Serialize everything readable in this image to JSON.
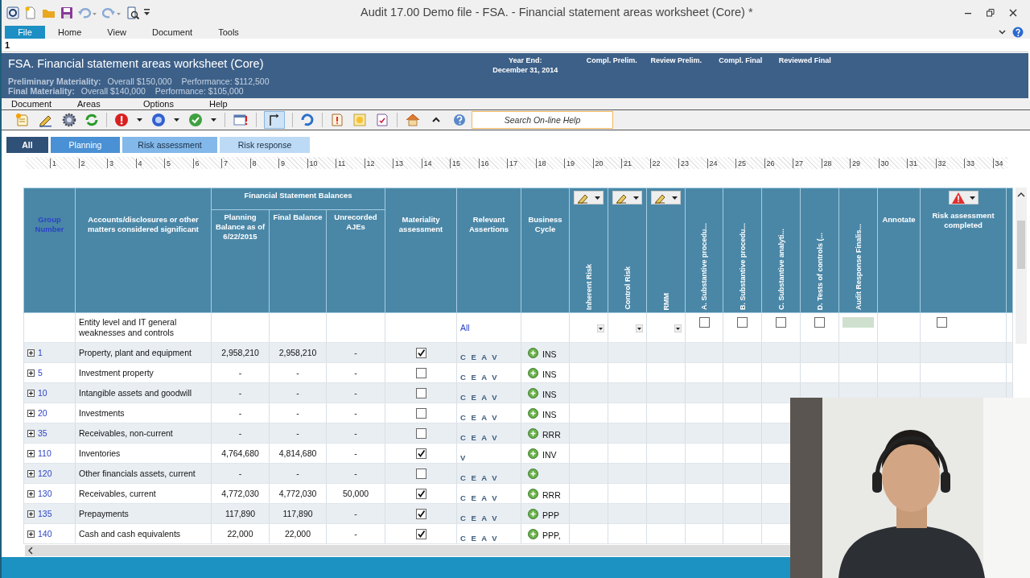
{
  "window": {
    "title": "Audit 17.00 Demo file - FSA. - Financial statement areas worksheet (Core) *"
  },
  "ribbon_tabs": [
    {
      "label": "File",
      "selected": true
    },
    {
      "label": "Home",
      "selected": false
    },
    {
      "label": "View",
      "selected": false
    },
    {
      "label": "Document",
      "selected": false
    },
    {
      "label": "Tools",
      "selected": false
    }
  ],
  "cell_editor": {
    "value": "1"
  },
  "document_header": {
    "title": "FSA. Financial statement areas worksheet (Core)",
    "materiality": [
      {
        "label": "Preliminary Materiality:",
        "overall": "Overall $150,000",
        "performance": "Performance: $112,500"
      },
      {
        "label": "Final Materiality:",
        "overall": "Overall $140,000",
        "performance": "Performance: $105,000"
      }
    ],
    "year_end": {
      "label": "Year End:",
      "value": "December 31, 2014"
    },
    "signoffs": [
      "Compl. Prelim.",
      "Review Prelim.",
      "Compl. Final",
      "Reviewed Final"
    ]
  },
  "menu": [
    "Document",
    "Areas",
    "Options",
    "Help"
  ],
  "search": {
    "placeholder": "Search On-line Help"
  },
  "filter_tabs": [
    {
      "label": "All",
      "selected": true
    },
    {
      "label": "Planning",
      "selected": false,
      "color": "#4a90d4"
    },
    {
      "label": "Risk assessment",
      "selected": false,
      "color": "#82b8ea"
    },
    {
      "label": "Risk response",
      "selected": false,
      "color": "#bcdaf5"
    }
  ],
  "ruler": [
    "1",
    "2",
    "3",
    "4",
    "5",
    "6",
    "7",
    "8",
    "9",
    "10",
    "11",
    "12",
    "13",
    "14",
    "15",
    "16",
    "17",
    "18",
    "19",
    "20",
    "21",
    "22",
    "23",
    "24",
    "25",
    "26",
    "27",
    "28",
    "29",
    "30",
    "31",
    "32",
    "33",
    "34"
  ],
  "table": {
    "columns": [
      {
        "kind": "link",
        "label": "Group Number"
      },
      {
        "kind": "text",
        "label": "Accounts/disclosures or other matters considered significant"
      },
      {
        "kind": "group",
        "label": "Financial Statement Balances",
        "columns": [
          {
            "label": "Planning Balance as of 6/22/2015"
          },
          {
            "label": "Final Balance"
          },
          {
            "label": "Unrecorded AJEs"
          }
        ]
      },
      {
        "kind": "text",
        "label": "Materiality assessment"
      },
      {
        "kind": "text",
        "label": "Relevant Assertions"
      },
      {
        "kind": "text",
        "label": "Business Cycle"
      },
      {
        "kind": "vertical_menu",
        "label": "Inherent Risk"
      },
      {
        "kind": "vertical_menu",
        "label": "Control Risk"
      },
      {
        "kind": "vertical_menu",
        "label": "RMM"
      },
      {
        "kind": "vertical",
        "label": "A. Substantive procedu..."
      },
      {
        "kind": "vertical",
        "label": "B. Substantive procedu..."
      },
      {
        "kind": "vertical",
        "label": "C. Substantive analyti..."
      },
      {
        "kind": "vertical",
        "label": "D. Tests of controls (..."
      },
      {
        "kind": "vertical",
        "label": "Audit Response Finalis..."
      },
      {
        "kind": "text",
        "label": "Annotate"
      },
      {
        "kind": "warning_menu",
        "label": "Risk assessment completed"
      }
    ],
    "entity_row": {
      "account": "Entity level and IT general weaknesses and controls",
      "assertions": "All",
      "procedures_checked": [
        false,
        false,
        false,
        false
      ],
      "risk_assessment_completed": false
    },
    "rows": [
      {
        "group": "1",
        "expanded": false,
        "account": "Property, plant and equipment",
        "planning": "2,958,210",
        "final": "2,958,210",
        "unrecorded": "-",
        "materiality_assessed": true,
        "assertions": "C E A V",
        "cycle": "INS"
      },
      {
        "group": "5",
        "expanded": false,
        "account": "Investment property",
        "planning": "-",
        "final": "-",
        "unrecorded": "-",
        "materiality_assessed": false,
        "assertions": "C E A V",
        "cycle": "INS"
      },
      {
        "group": "10",
        "expanded": false,
        "account": "Intangible assets and goodwill",
        "planning": "-",
        "final": "-",
        "unrecorded": "-",
        "materiality_assessed": false,
        "assertions": "C E A V",
        "cycle": "INS"
      },
      {
        "group": "20",
        "expanded": false,
        "account": "Investments",
        "planning": "-",
        "final": "-",
        "unrecorded": "-",
        "materiality_assessed": false,
        "assertions": "C E A V",
        "cycle": "INS"
      },
      {
        "group": "35",
        "expanded": false,
        "account": "Receivables, non-current",
        "planning": "-",
        "final": "-",
        "unrecorded": "-",
        "materiality_assessed": false,
        "assertions": "C E A V",
        "cycle": "RRR"
      },
      {
        "group": "110",
        "expanded": false,
        "account": "Inventories",
        "planning": "4,764,680",
        "final": "4,814,680",
        "unrecorded": "-",
        "materiality_assessed": true,
        "assertions": "V",
        "cycle": "INV"
      },
      {
        "group": "120",
        "expanded": false,
        "account": "Other financials assets, current",
        "planning": "-",
        "final": "-",
        "unrecorded": "-",
        "materiality_assessed": false,
        "assertions": "C E A V"
      },
      {
        "group": "130",
        "expanded": false,
        "account": "Receivables, current",
        "planning": "4,772,030",
        "final": "4,772,030",
        "unrecorded": "50,000",
        "materiality_assessed": true,
        "assertions": "C E A V",
        "cycle": "RRR"
      },
      {
        "group": "135",
        "expanded": false,
        "account": "Prepayments",
        "planning": "117,890",
        "final": "117,890",
        "unrecorded": "-",
        "materiality_assessed": true,
        "assertions": "C E A V",
        "cycle": "PPP"
      },
      {
        "group": "140",
        "expanded": false,
        "account": "Cash and cash equivalents",
        "planning": "22,000",
        "final": "22,000",
        "unrecorded": "-",
        "materiality_assessed": true,
        "assertions": "C E A V",
        "cycle": "PPP,"
      }
    ]
  }
}
